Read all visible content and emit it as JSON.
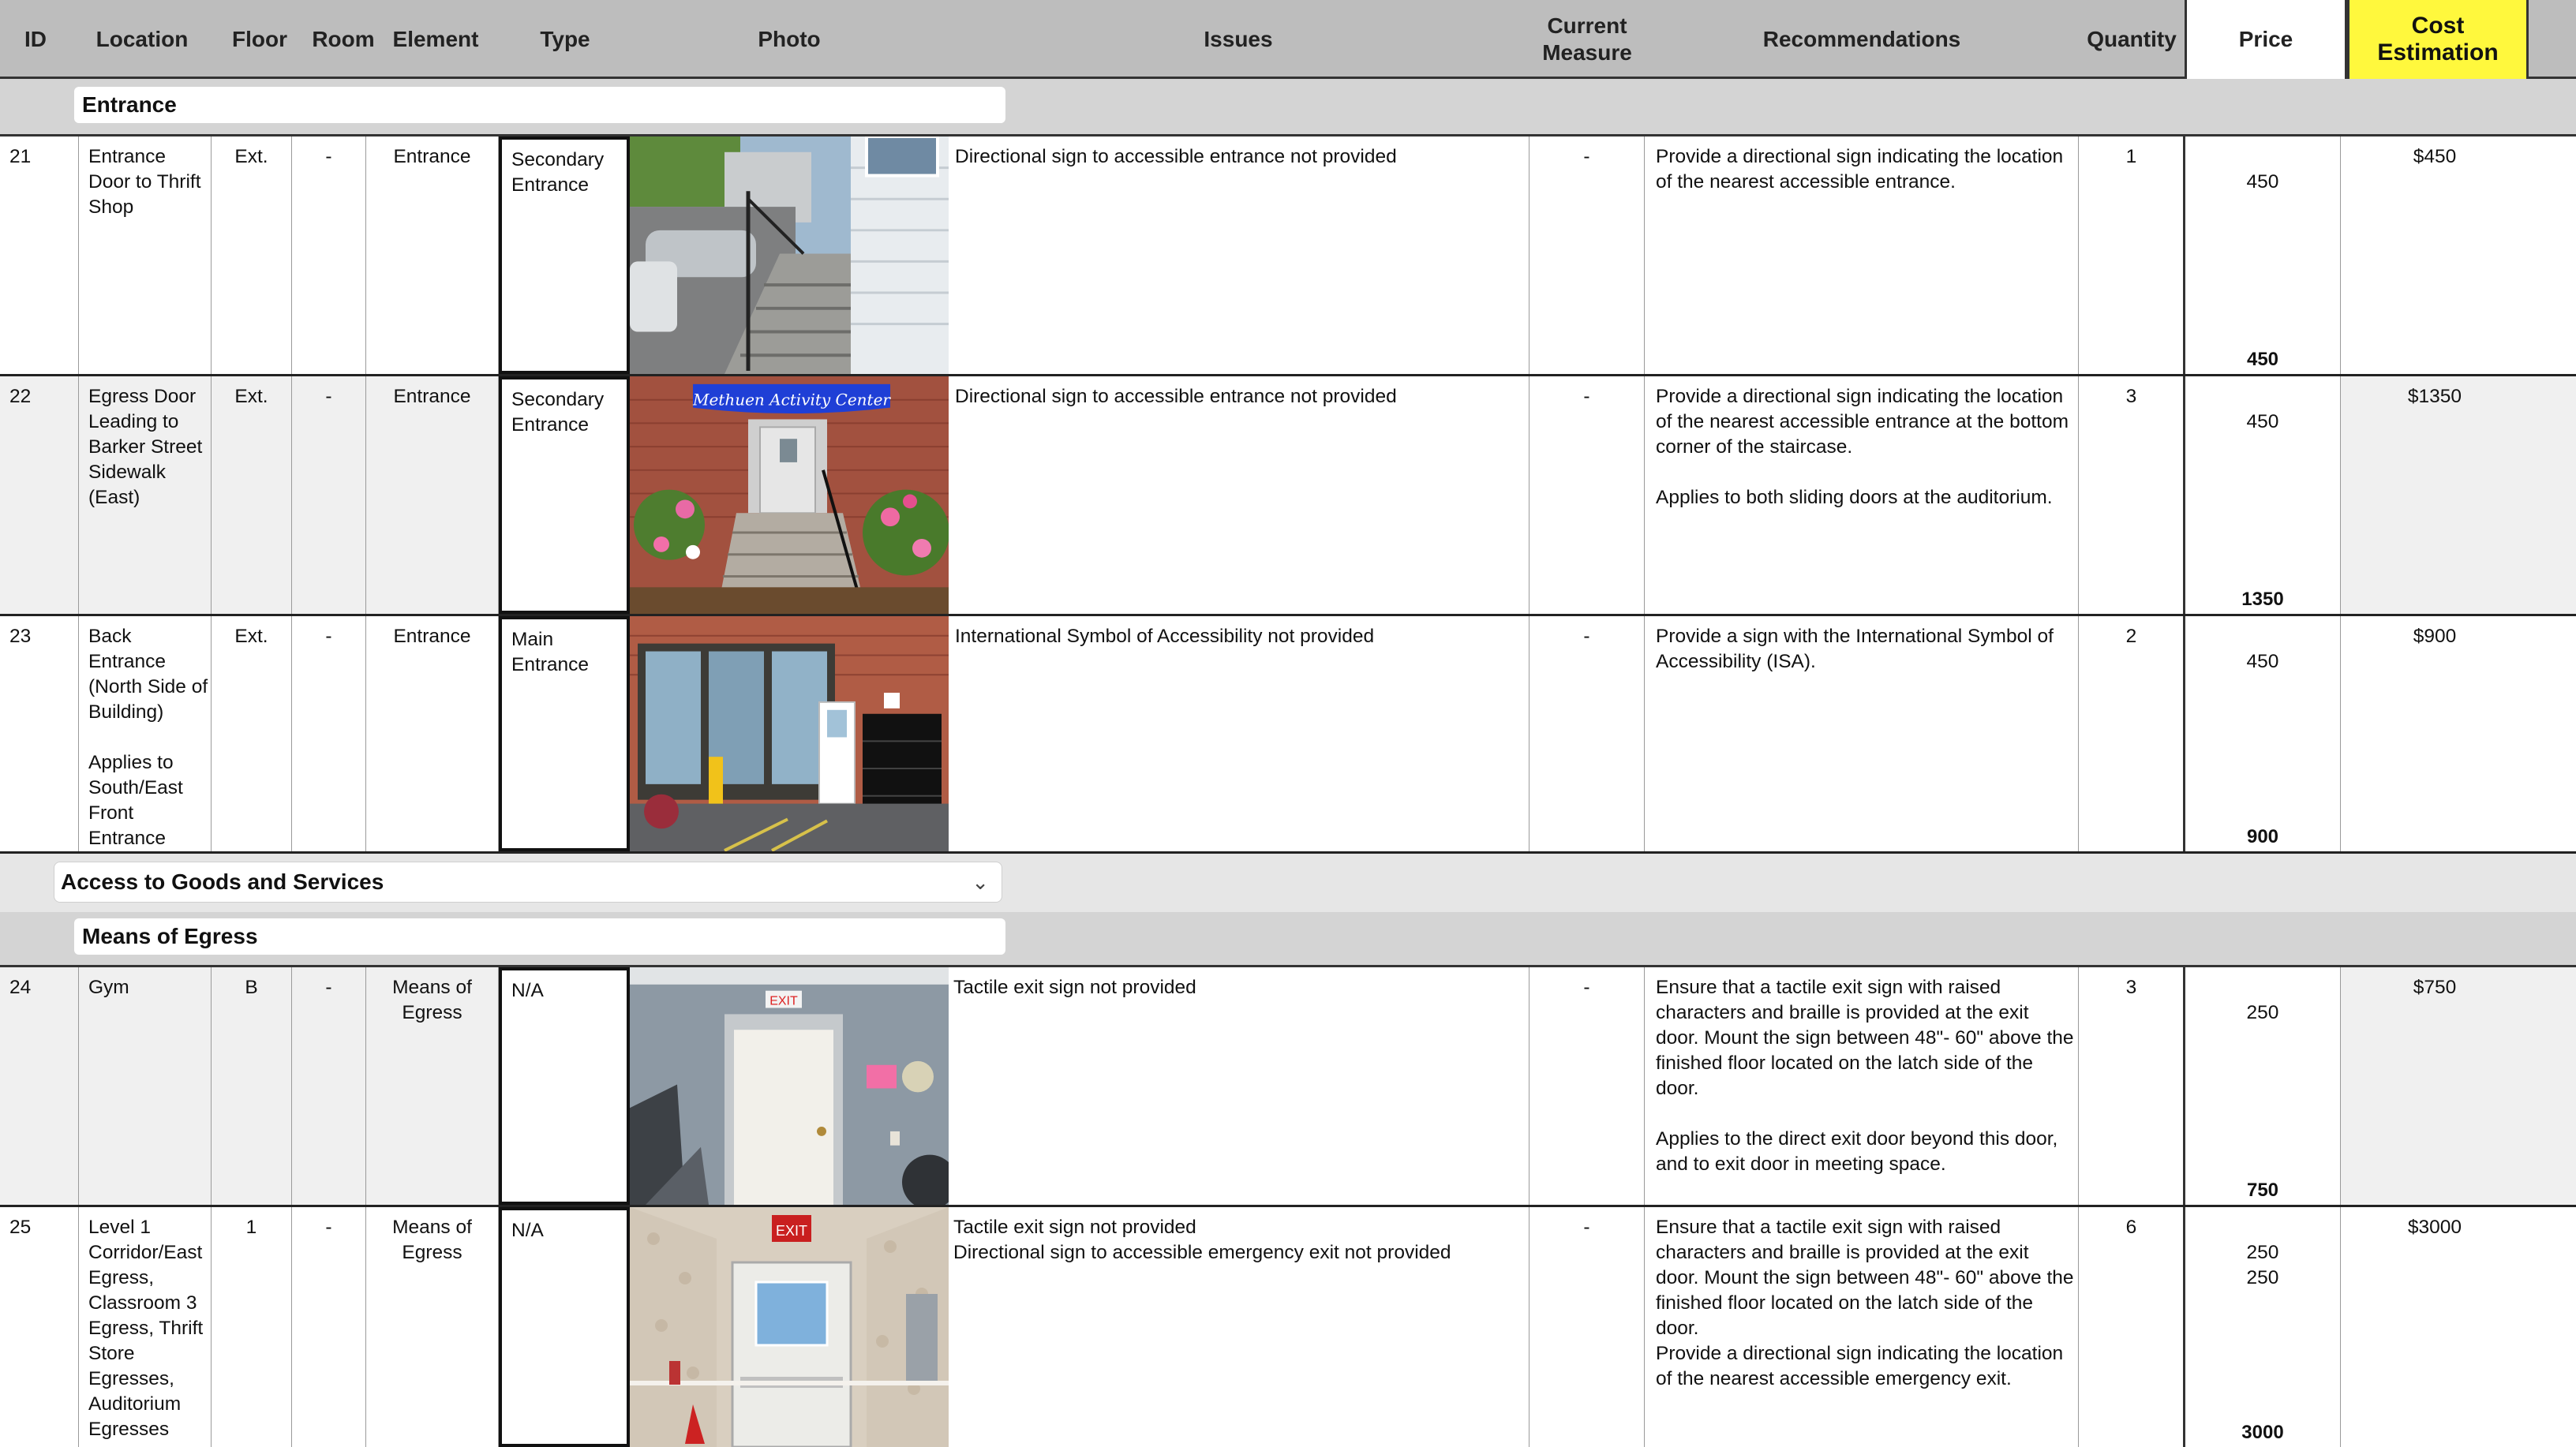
{
  "headers": {
    "id": "ID",
    "location": "Location",
    "floor": "Floor",
    "room": "Room",
    "element": "Element",
    "type": "Type",
    "photo": "Photo",
    "issues": "Issues",
    "current_measure": "Current\nMeasure",
    "recommendations": "Recommendations",
    "quantity": "Quantity",
    "price": "Price",
    "cost_estimation": "Cost\nEstimation"
  },
  "sections": {
    "entrance": "Entrance",
    "access_dropdown": "Access to Goods and Services",
    "means_of_egress": "Means of Egress"
  },
  "rows": [
    {
      "id": "21",
      "location": "Entrance\nDoor to Thrift\nShop",
      "floor": "Ext.",
      "room": "-",
      "element": "Entrance",
      "type": "Secondary\nEntrance",
      "photo": "exterior-stairs-photo",
      "issues": "Directional sign to accessible entrance not provided",
      "current_measure": "-",
      "recommendations": "Provide a directional sign indicating the location\nof the nearest accessible entrance.",
      "quantity": "1",
      "price": "450",
      "price_total": "450",
      "cost": "$450"
    },
    {
      "id": "22",
      "location": "Egress Door\nLeading to\nBarker Street\nSidewalk\n(East)",
      "floor": "Ext.",
      "room": "-",
      "element": "Entrance",
      "type": "Secondary\nEntrance",
      "photo": "activity-center-stairs-photo",
      "photo_sign": "Methuen Activity Center",
      "issues": "Directional sign to accessible entrance not provided",
      "current_measure": "-",
      "recommendations": "Provide a directional sign indicating the location\nof the nearest accessible entrance at the bottom\ncorner of the staircase.\n\nApplies to both sliding doors at the auditorium.",
      "quantity": "3",
      "price": "450",
      "price_total": "1350",
      "cost": "$1350"
    },
    {
      "id": "23",
      "location": "Back\nEntrance\n(North Side of\nBuilding)\n\nApplies to\nSouth/East\nFront\nEntrance",
      "floor": "Ext.",
      "room": "-",
      "element": "Entrance",
      "type": "Main\nEntrance",
      "photo": "back-entrance-photo",
      "issues": "International Symbol of Accessibility not provided",
      "current_measure": "-",
      "recommendations": "Provide a sign with the International Symbol of\nAccessibility (ISA).",
      "quantity": "2",
      "price": "450",
      "price_total": "900",
      "cost": "$900"
    },
    {
      "id": "24",
      "location": "Gym",
      "floor": "B",
      "room": "-",
      "element": "Means of\nEgress",
      "type": "N/A",
      "photo": "gym-exit-door-photo",
      "photo_sign": "EXIT",
      "issues": "Tactile exit sign not provided",
      "current_measure": "-",
      "recommendations": "Ensure that a tactile exit sign with raised\ncharacters and braille is provided at the exit\ndoor. Mount the sign between 48\"- 60\" above the\nfinished floor located on the latch side of the\ndoor.\n\nApplies to the direct exit door beyond this door,\nand to exit door in meeting space.",
      "quantity": "3",
      "price": "250",
      "price_total": "750",
      "cost": "$750"
    },
    {
      "id": "25",
      "location": "Level 1\nCorridor/East\nEgress,\nClassroom 3\nEgress, Thrift\nStore\nEgresses,\nAuditorium\nEgresses",
      "floor": "1",
      "room": "-",
      "element": "Means of\nEgress",
      "type": "N/A",
      "photo": "corridor-exit-door-photo",
      "photo_sign": "EXIT",
      "issues": "Tactile exit sign not provided\nDirectional sign to accessible emergency exit not provided",
      "current_measure": "-",
      "recommendations": "Ensure that a tactile exit sign with raised\ncharacters and braille is provided at the exit\ndoor. Mount the sign between 48\"- 60\" above the\nfinished floor located on the latch side of the\ndoor.\nProvide a directional sign indicating the location\nof the nearest accessible emergency exit.",
      "quantity": "6",
      "price": "250\n250",
      "price_total": "3000",
      "cost": "$3000"
    }
  ]
}
